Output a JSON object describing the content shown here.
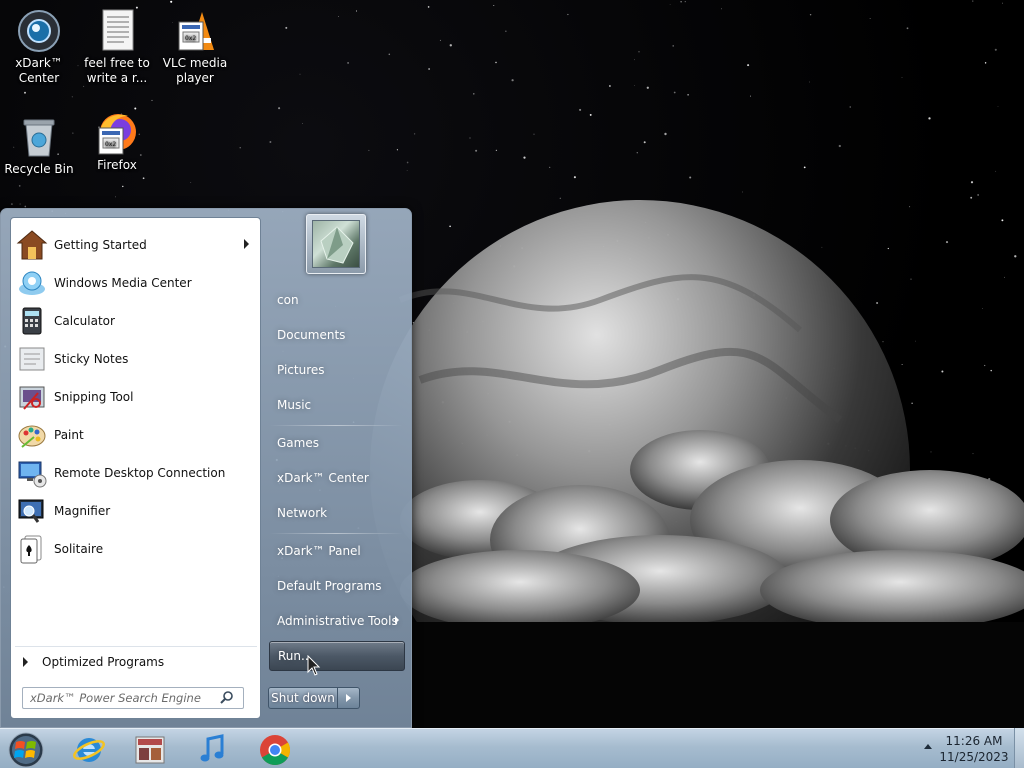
{
  "desktop": {
    "icons": [
      {
        "label": "xDark™ Center",
        "icon": "xdark-center-icon"
      },
      {
        "label": "feel free to write a r...",
        "icon": "text-document-icon"
      },
      {
        "label": "VLC media player",
        "icon": "vlc-icon"
      },
      {
        "label": "Recycle Bin",
        "icon": "recycle-bin-icon"
      },
      {
        "label": "Firefox",
        "icon": "firefox-icon"
      }
    ]
  },
  "start_menu": {
    "programs": [
      {
        "label": "Getting Started",
        "icon": "getting-started-icon",
        "has_submenu": true
      },
      {
        "label": "Windows Media Center",
        "icon": "media-center-icon"
      },
      {
        "label": "Calculator",
        "icon": "calculator-icon"
      },
      {
        "label": "Sticky Notes",
        "icon": "sticky-notes-icon"
      },
      {
        "label": "Snipping Tool",
        "icon": "snipping-tool-icon"
      },
      {
        "label": "Paint",
        "icon": "paint-icon"
      },
      {
        "label": "Remote Desktop Connection",
        "icon": "remote-desktop-icon"
      },
      {
        "label": "Magnifier",
        "icon": "magnifier-icon"
      },
      {
        "label": "Solitaire",
        "icon": "solitaire-icon"
      }
    ],
    "all_programs_label": "Optimized Programs",
    "search": {
      "placeholder": "xDark™ Power Search Engine"
    },
    "right": {
      "user_name": "con",
      "items": [
        {
          "label": "Documents"
        },
        {
          "label": "Pictures"
        },
        {
          "label": "Music"
        },
        {
          "label": "Games"
        },
        {
          "label": "xDark™ Center"
        },
        {
          "label": "Network"
        },
        {
          "label": "xDark™ Panel"
        },
        {
          "label": "Default Programs"
        },
        {
          "label": "Administrative Tools",
          "has_submenu": true
        },
        {
          "label": "Run...",
          "highlighted": true
        }
      ]
    },
    "shutdown_label": "Shut down"
  },
  "taskbar": {
    "pinned": [
      {
        "name": "internet-explorer",
        "icon": "internet-explorer-icon"
      },
      {
        "name": "media-app",
        "icon": "media-app-icon"
      },
      {
        "name": "itunes",
        "icon": "music-note-icon"
      },
      {
        "name": "chrome",
        "icon": "chrome-icon"
      }
    ],
    "clock": {
      "time": "11:26 AM",
      "date": "11/25/2023"
    }
  },
  "colors": {
    "taskbar": "#a6bccf",
    "menu_frame": "#8a9aac",
    "run_highlight": "#4c5866"
  }
}
